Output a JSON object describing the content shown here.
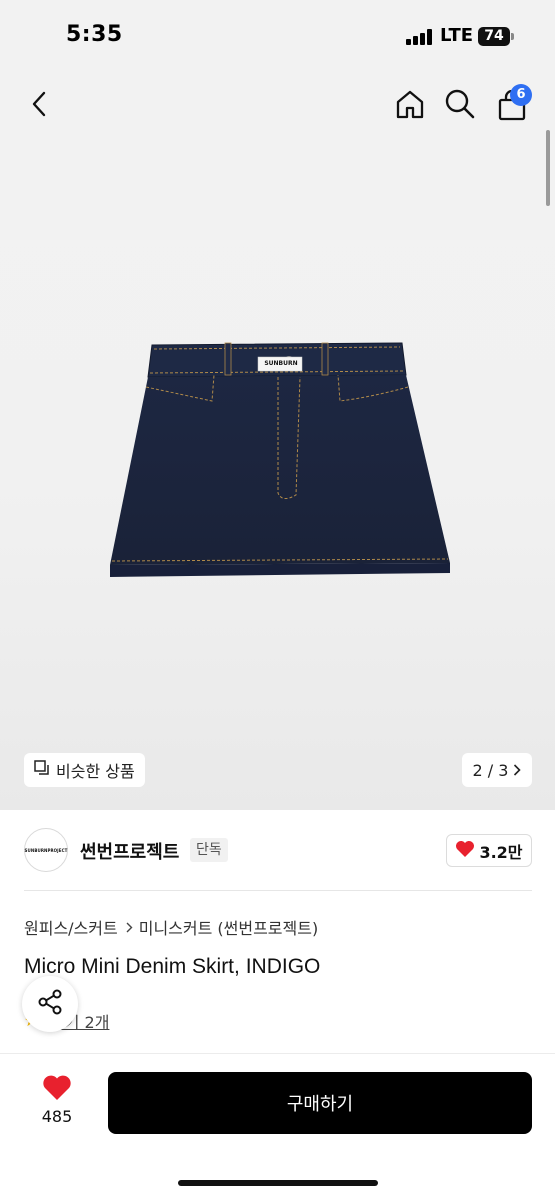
{
  "status_bar": {
    "time": "5:35",
    "network": "LTE",
    "battery": "74"
  },
  "nav": {
    "back_icon": "chevron-left-icon",
    "home_icon": "home-icon",
    "search_icon": "search-icon",
    "cart_icon": "shopping-bag-icon",
    "cart_count": "6"
  },
  "gallery": {
    "similar_label": "비슷한 상품",
    "page_indicator": "2 / 3",
    "product_image_label": "SUNBURN"
  },
  "brand": {
    "logo_text": "SUNBURNPROJECT",
    "name": "썬번프로젝트",
    "tag": "단독",
    "likes": "3.2만"
  },
  "breadcrumb": {
    "category": "원피스/스커트",
    "subcategory": "미니스커트 (썬번프로젝트)"
  },
  "product": {
    "title": "Micro Mini Denim Skirt, INDIGO",
    "review_text": "후기 2개"
  },
  "bottom": {
    "wish_count": "485",
    "buy_label": "구매하기"
  },
  "colors": {
    "accent": "#2f6ff2",
    "heart": "#e8212e",
    "buy_button": "#000000"
  }
}
